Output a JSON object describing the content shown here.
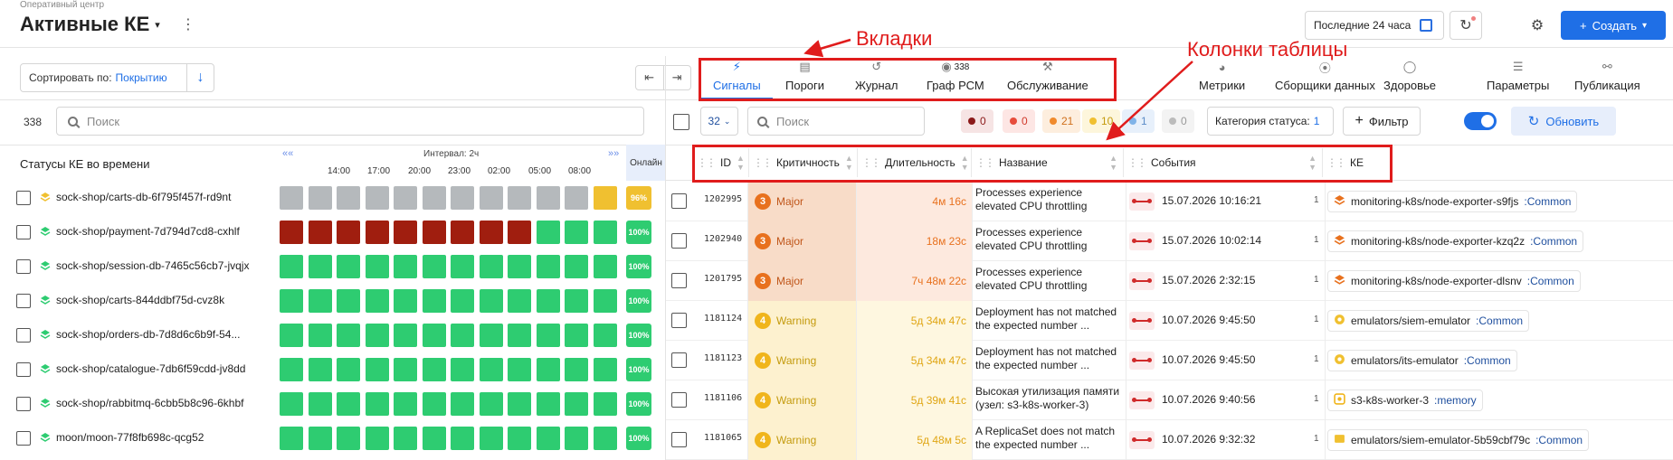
{
  "header": {
    "breadcrumb": "Оперативный центр",
    "title": "Активные КЕ",
    "period": "Последние 24 часа",
    "create_label": "Создать"
  },
  "left": {
    "sort_label": "Сортировать по:",
    "sort_value": "Покрытию",
    "count": "338",
    "search_placeholder": "Поиск",
    "timeline_title": "Статусы КЕ во времени",
    "interval": "Интервал: 2ч",
    "online": "Онлайн",
    "ticks": [
      "14:00",
      "17:00",
      "20:00",
      "23:00",
      "02:00",
      "05:00",
      "08:00"
    ],
    "rows": [
      {
        "name": "sock-shop/carts-db-6f795f457f-rd9nt",
        "icon": "yellow",
        "cells": [
          "g",
          "g",
          "g",
          "g",
          "g",
          "g",
          "g",
          "g",
          "g",
          "g",
          "g",
          "y"
        ],
        "pct": "96%",
        "pct_color": "#f0c030"
      },
      {
        "name": "sock-shop/payment-7d794d7cd8-cxhlf",
        "icon": "green",
        "cells": [
          "r",
          "r",
          "r",
          "r",
          "r",
          "r",
          "r",
          "r",
          "r",
          "n",
          "n",
          "n"
        ],
        "pct": "100%",
        "pct_color": "#2ecc71"
      },
      {
        "name": "sock-shop/session-db-7465c56cb7-jvqjx",
        "icon": "green",
        "cells": [
          "n",
          "n",
          "n",
          "n",
          "n",
          "n",
          "n",
          "n",
          "n",
          "n",
          "n",
          "n"
        ],
        "pct": "100%",
        "pct_color": "#2ecc71"
      },
      {
        "name": "sock-shop/carts-844ddbf75d-cvz8k",
        "icon": "green",
        "cells": [
          "n",
          "n",
          "n",
          "n",
          "n",
          "n",
          "n",
          "n",
          "n",
          "n",
          "n",
          "n"
        ],
        "pct": "100%",
        "pct_color": "#2ecc71"
      },
      {
        "name": "sock-shop/orders-db-7d8d6c6b9f-54...",
        "icon": "green",
        "cells": [
          "n",
          "n",
          "n",
          "n",
          "n",
          "n",
          "n",
          "n",
          "n",
          "n",
          "n",
          "n"
        ],
        "pct": "100%",
        "pct_color": "#2ecc71"
      },
      {
        "name": "sock-shop/catalogue-7db6f59cdd-jv8dd",
        "icon": "green",
        "cells": [
          "n",
          "n",
          "n",
          "n",
          "n",
          "n",
          "n",
          "n",
          "n",
          "n",
          "n",
          "n"
        ],
        "pct": "100%",
        "pct_color": "#2ecc71"
      },
      {
        "name": "sock-shop/rabbitmq-6cbb5b8c96-6khbf",
        "icon": "green",
        "cells": [
          "n",
          "n",
          "n",
          "n",
          "n",
          "n",
          "n",
          "n",
          "n",
          "n",
          "n",
          "n"
        ],
        "pct": "100%",
        "pct_color": "#2ecc71"
      },
      {
        "name": "moon/moon-77f8fb698c-qcg52",
        "icon": "green",
        "cells": [
          "n",
          "n",
          "n",
          "n",
          "n",
          "n",
          "n",
          "n",
          "n",
          "n",
          "n",
          "n"
        ],
        "pct": "100%",
        "pct_color": "#2ecc71"
      }
    ]
  },
  "tabs": [
    {
      "label": "Сигналы",
      "icon": "lightning-icon"
    },
    {
      "label": "Пороги",
      "icon": "bars-icon"
    },
    {
      "label": "Журнал",
      "icon": "history-icon"
    },
    {
      "label": "Граф РСМ",
      "icon": "graph-icon",
      "badge": "338"
    },
    {
      "label": "Обслуживание",
      "icon": "wrench-icon"
    },
    {
      "label": "Метрики",
      "icon": "metrics-icon"
    },
    {
      "label": "Сборщики данных",
      "icon": "collector-icon"
    },
    {
      "label": "Здоровье",
      "icon": "health-icon"
    },
    {
      "label": "Параметры",
      "icon": "params-icon"
    },
    {
      "label": "Публикация",
      "icon": "publish-icon"
    }
  ],
  "toolbar": {
    "page_size": "32",
    "search_placeholder": "Поиск",
    "chips": [
      {
        "count": "0",
        "dot": "#8b1a1a",
        "bg": "#f6e4e4",
        "fg": "#8b1a1a"
      },
      {
        "count": "0",
        "dot": "#e74c3c",
        "bg": "#fde6e4",
        "fg": "#d0392b"
      },
      {
        "count": "21",
        "dot": "#f08a2c",
        "bg": "#fdeede",
        "fg": "#d0701c"
      },
      {
        "count": "10",
        "dot": "#f0c030",
        "bg": "#fdf6dc",
        "fg": "#c49a0c"
      },
      {
        "count": "1",
        "dot": "#7fb3e8",
        "bg": "#e7f0fb",
        "fg": "#5b8cc8"
      },
      {
        "count": "0",
        "dot": "#bbbbbb",
        "bg": "#f3f3f3",
        "fg": "#999999"
      }
    ],
    "status_category_label": "Категория статуса:",
    "status_category_value": "1",
    "filter_label": "Фильтр",
    "update_label": "Обновить"
  },
  "table": {
    "columns": [
      "ID",
      "Критичность",
      "Длительность",
      "Название",
      "События",
      "КЕ"
    ],
    "rows": [
      {
        "id": "1202995",
        "crit_num": "3",
        "crit": "Major",
        "level": "major",
        "dur": "4м 16с",
        "name": "Processes experience elevated CPU throttling",
        "date": "15.07.2026 10:16:21",
        "cnt": "1",
        "ke": "monitoring-k8s/node-exporter-s9fjs",
        "ke_sub": ":Common",
        "ke_icon": "orange-layers"
      },
      {
        "id": "1202940",
        "crit_num": "3",
        "crit": "Major",
        "level": "major",
        "dur": "18м 23с",
        "name": "Processes experience elevated CPU throttling",
        "date": "15.07.2026 10:02:14",
        "cnt": "1",
        "ke": "monitoring-k8s/node-exporter-kzq2z",
        "ke_sub": ":Common",
        "ke_icon": "orange-layers"
      },
      {
        "id": "1201795",
        "crit_num": "3",
        "crit": "Major",
        "level": "major",
        "dur": "7ч 48м 22с",
        "name": "Processes experience elevated CPU throttling",
        "date": "15.07.2026 2:32:15",
        "cnt": "1",
        "ke": "monitoring-k8s/node-exporter-dlsnv",
        "ke_sub": ":Common",
        "ke_icon": "orange-layers"
      },
      {
        "id": "1181124",
        "crit_num": "4",
        "crit": "Warning",
        "level": "warning",
        "dur": "5д 34м 47с",
        "name": "Deployment has not matched the expected number ...",
        "date": "10.07.2026 9:45:50",
        "cnt": "1",
        "ke": "emulators/siem-emulator",
        "ke_sub": ":Common",
        "ke_icon": "yellow-circle"
      },
      {
        "id": "1181123",
        "crit_num": "4",
        "crit": "Warning",
        "level": "warning",
        "dur": "5д 34м 47с",
        "name": "Deployment has not matched the expected number ...",
        "date": "10.07.2026 9:45:50",
        "cnt": "1",
        "ke": "emulators/its-emulator",
        "ke_sub": ":Common",
        "ke_icon": "yellow-circle"
      },
      {
        "id": "1181106",
        "crit_num": "4",
        "crit": "Warning",
        "level": "warning",
        "dur": "5д 39м 41с",
        "name": "Высокая утилизация памяти (узел: s3-k8s-worker-3)",
        "date": "10.07.2026 9:40:56",
        "cnt": "1",
        "ke": "s3-k8s-worker-3",
        "ke_sub": ":memory",
        "ke_icon": "yellow-node"
      },
      {
        "id": "1181065",
        "crit_num": "4",
        "crit": "Warning",
        "level": "warning",
        "dur": "5д 48м 5с",
        "name": "A ReplicaSet does not match the expected number ...",
        "date": "10.07.2026 9:32:32",
        "cnt": "1",
        "ke": "emulators/siem-emulator-5b59cbf79c",
        "ke_sub": ":Common",
        "ke_icon": "yellow-box"
      }
    ]
  },
  "annotations": {
    "tabs_label": "Вкладки",
    "columns_label": "Колонки таблицы"
  },
  "colors": {
    "accent": "#1f6fe6",
    "major_bg": "#f8dcc8",
    "major_dot": "#e8711e",
    "warning_bg": "#fdf1cf",
    "warning_dot": "#f0b51c",
    "cell_green": "#2ecc71",
    "cell_gray": "#b5b9bc",
    "cell_red": "#a01e0f",
    "cell_yellow": "#f0c030",
    "annotation": "#e01c1c"
  }
}
